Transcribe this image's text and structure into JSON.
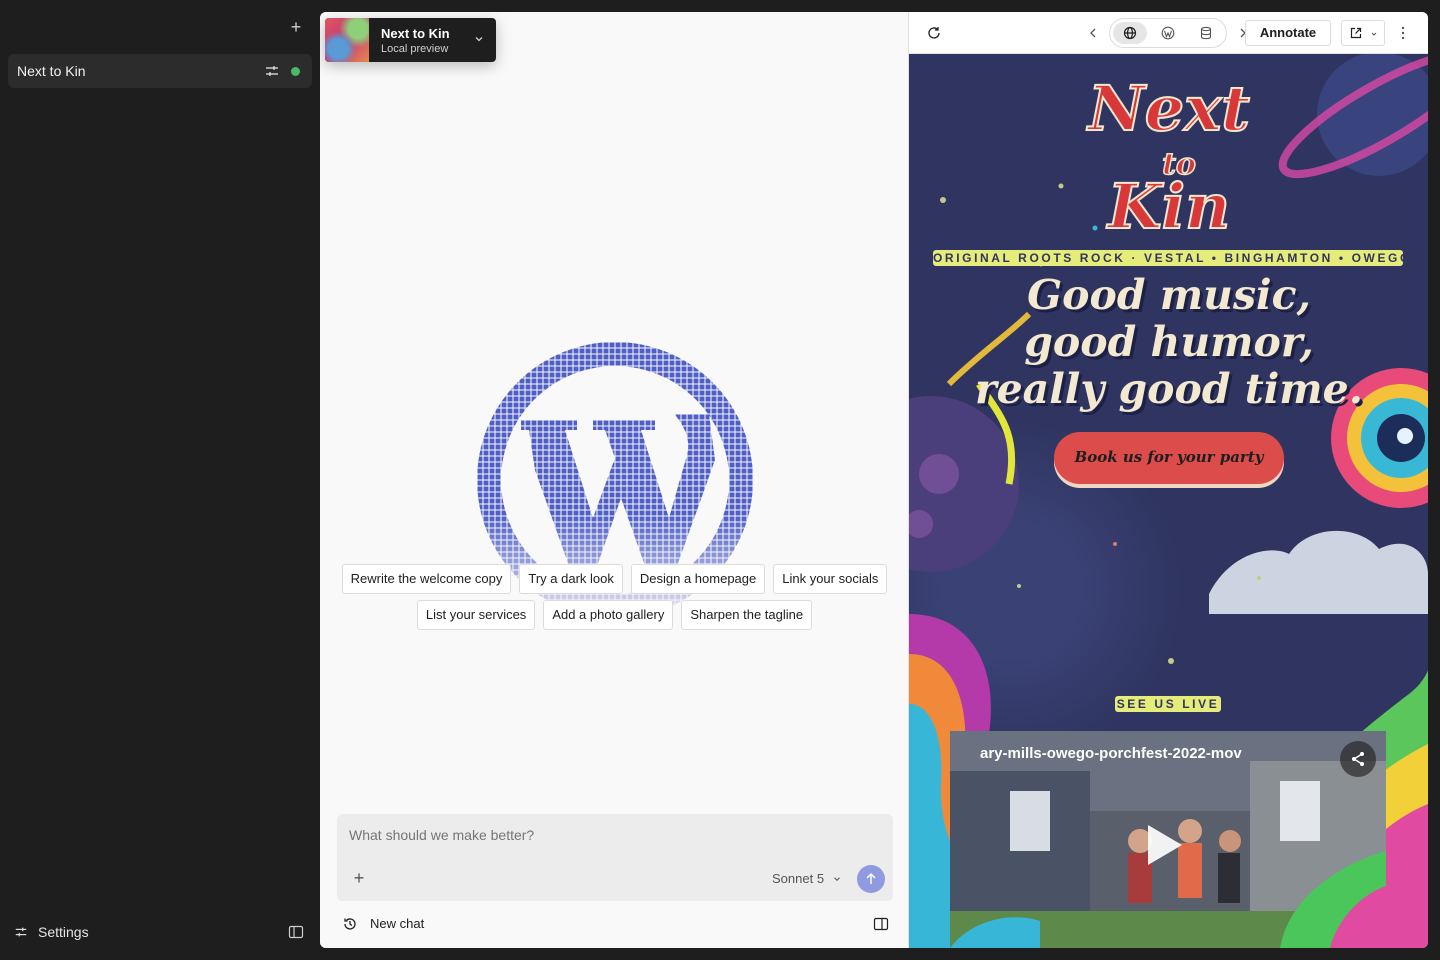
{
  "sidebar": {
    "site_name": "Next to Kin",
    "status_color": "#4ab866",
    "settings_label": "Settings"
  },
  "site_switcher": {
    "name": "Next to Kin",
    "subtitle": "Local preview"
  },
  "suggestions": {
    "row1": [
      "Rewrite the welcome copy",
      "Try a dark look",
      "Design a homepage",
      "Link your socials"
    ],
    "row2": [
      "List your services",
      "Add a photo gallery",
      "Sharpen the tagline"
    ]
  },
  "composer": {
    "placeholder": "What should we make better?",
    "model": "Sonnet 5",
    "accent": "#8f9ae0"
  },
  "chat_footer": {
    "new_chat_label": "New chat"
  },
  "preview_toolbar": {
    "annotate_label": "Annotate"
  },
  "website": {
    "logo_line1": "Next",
    "logo_line2": "to",
    "logo_line3": "Kin",
    "tagline": "ORIGINAL ROOTS ROCK · VESTAL • BINGHAMTON • OWEGO",
    "hero_line1": "Good music,",
    "hero_line2": "good humor,",
    "hero_line3": "really good time.",
    "cta_label": "Book us for your party",
    "see_live_label": "SEE US LIVE",
    "video_title": "ary-mills-owego-porchfest-2022-mov",
    "background": "#2f3560",
    "accent_yellow": "#e6ec7a",
    "accent_red": "#db4c4a"
  }
}
